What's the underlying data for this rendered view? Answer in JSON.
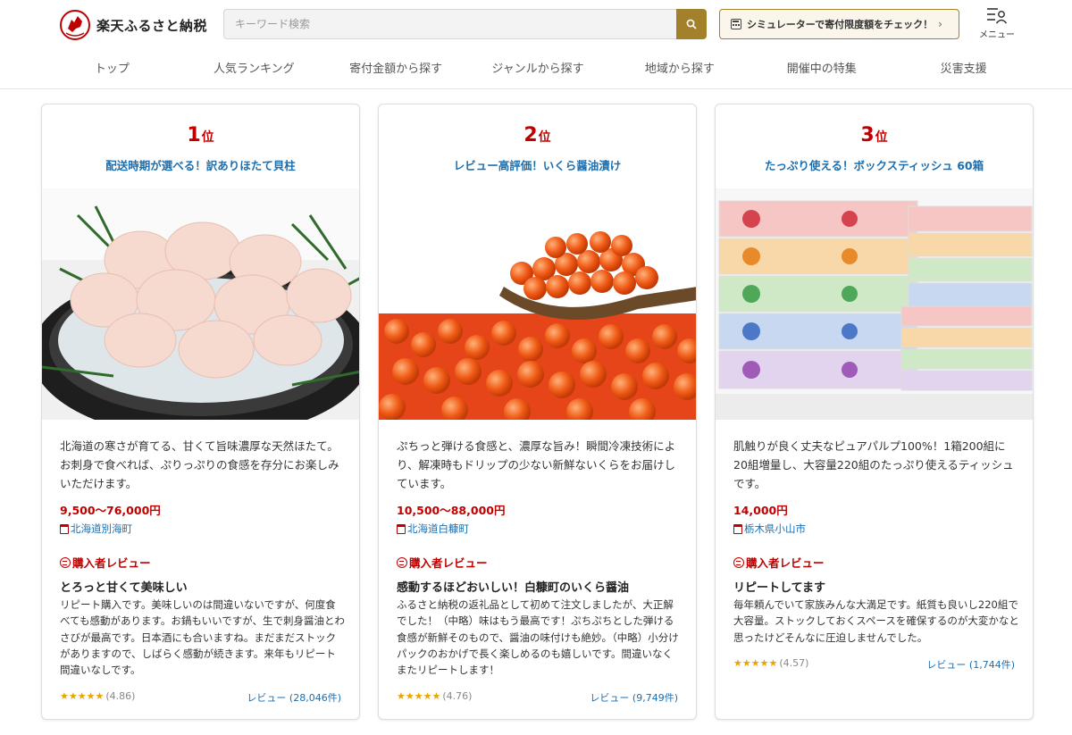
{
  "header": {
    "logo_text": "楽天ふるさと納税",
    "search_placeholder": "キーワード検索",
    "simulator_label": "シミュレーターで寄付限度額をチェック！",
    "menu_label": "メニュー"
  },
  "nav": [
    "トップ",
    "人気ランキング",
    "寄付金額から探す",
    "ジャンルから探す",
    "地域から探す",
    "開催中の特集",
    "災害支援"
  ],
  "colors": {
    "accent": "#bf0000",
    "link": "#1b6fb0",
    "gold": "#a3802a",
    "star": "#e8a400"
  },
  "cards": [
    {
      "rank": "1",
      "rank_suffix": "位",
      "title": "配送時期が選べる！訳ありほたて貝柱",
      "description": "北海道の寒さが育てる、甘くて旨味濃厚な天然ほたて。お刺身で食べれば、ぷりっぷりの食感を存分にお楽しみいただけます。",
      "price": "9,500〜76,000円",
      "location": "北海道別海町",
      "review_heading": "購入者レビュー",
      "review_title": "とろっと甘くて美味しい",
      "review_body": "リピート購入です。美味しいのは間違いないですが、何度食べても感動があります。お鍋もいいですが、生で刺身醤油とわさびが最高です。日本酒にも合いますね。まだまだストックがありますので、しばらく感動が続きます。来年もリピート間違いなしです。",
      "stars": "★★★★★",
      "rating": "(4.86)",
      "review_count": "レビュー (28,046件)"
    },
    {
      "rank": "2",
      "rank_suffix": "位",
      "title": "レビュー高評価！いくら醤油漬け",
      "description": "ぷちっと弾ける食感と、濃厚な旨み！瞬間冷凍技術により、解凍時もドリップの少ない新鮮ないくらをお届けしています。",
      "price": "10,500〜88,000円",
      "location": "北海道白糠町",
      "review_heading": "購入者レビュー",
      "review_title": "感動するほどおいしい！白糠町のいくら醤油",
      "review_body": "ふるさと納税の返礼品として初めて注文しましたが、大正解でした！（中略）味はもう最高です！ぷちぷちとした弾ける食感が新鮮そのもので、醤油の味付けも絶妙。（中略）小分けパックのおかげで長く楽しめるのも嬉しいです。間違いなくまたリピートします！",
      "stars": "★★★★★",
      "rating": "(4.76)",
      "review_count": "レビュー (9,749件)"
    },
    {
      "rank": "3",
      "rank_suffix": "位",
      "title": "たっぷり使える！ボックスティッシュ 60箱",
      "description": "肌触りが良く丈夫なピュアパルプ100%！1箱200組に20組増量し、大容量220組のたっぷり使えるティッシュです。",
      "price": "14,000円",
      "location": "栃木県小山市",
      "review_heading": "購入者レビュー",
      "review_title": "リピートしてます",
      "review_body": "毎年頼んでいて家族みんな大満足です。紙質も良いし220組で大容量。ストックしておくスペースを確保するのが大変かなと思ったけどそんなに圧迫しませんでした。",
      "stars": "★★★★★",
      "rating": "(4.57)",
      "review_count": "レビュー (1,744件)"
    }
  ]
}
